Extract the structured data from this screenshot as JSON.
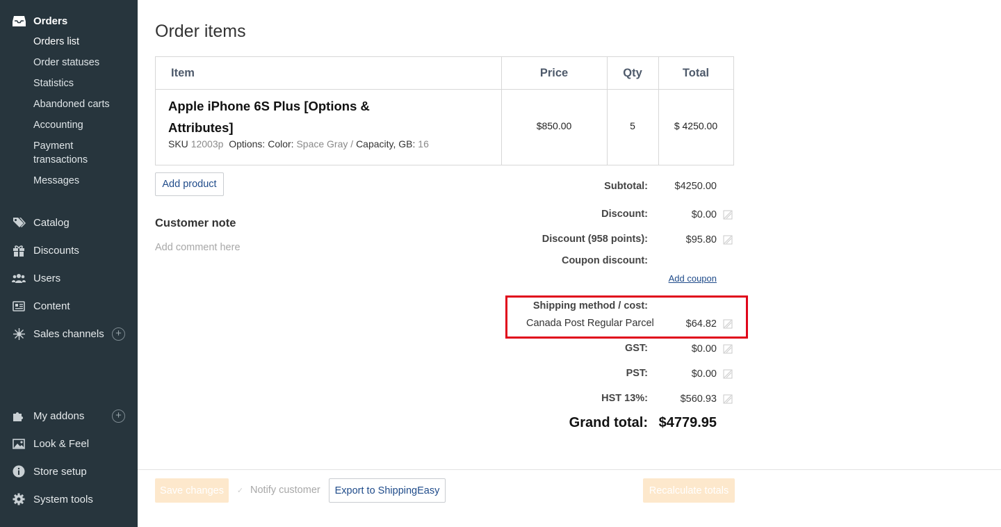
{
  "sidebar": {
    "orders": {
      "label": "Orders",
      "icon": "orders-inbox-icon",
      "items": [
        {
          "label": "Orders list"
        },
        {
          "label": "Order statuses"
        },
        {
          "label": "Statistics"
        },
        {
          "label": "Abandoned carts"
        },
        {
          "label": "Accounting"
        },
        {
          "label": "Payment"
        },
        {
          "label": "transactions"
        },
        {
          "label": "Messages"
        }
      ]
    },
    "sections": [
      {
        "label": "Catalog",
        "icon": "tags-icon"
      },
      {
        "label": "Discounts",
        "icon": "gift-icon"
      },
      {
        "label": "Users",
        "icon": "users-icon"
      },
      {
        "label": "Content",
        "icon": "newspaper-icon"
      },
      {
        "label": "Sales channels",
        "icon": "network-icon",
        "plus": "+"
      }
    ],
    "bottom": [
      {
        "label": "My addons",
        "icon": "puzzle-icon",
        "plus": "+"
      },
      {
        "label": "Look & Feel",
        "icon": "image-icon"
      },
      {
        "label": "Store setup",
        "icon": "info-icon"
      },
      {
        "label": "System tools",
        "icon": "gear-icon"
      }
    ]
  },
  "main": {
    "title": "Order items",
    "table": {
      "headers": {
        "item": "Item",
        "price": "Price",
        "qty": "Qty",
        "total": "Total"
      },
      "rows": [
        {
          "name": "Apple iPhone 6S Plus [Options & Attributes]",
          "sku_label": "SKU",
          "sku": "12003p",
          "options_label": "Options: Color:",
          "color": "Space Gray",
          "separator": "/",
          "capacity_label": "Capacity, GB:",
          "capacity": "16",
          "price": "$850.00",
          "qty": "5",
          "total": "$ 4250.00"
        }
      ]
    },
    "add_product": "Add product",
    "customer_note": {
      "title": "Customer note",
      "placeholder": "Add comment here"
    },
    "totals": {
      "subtotal_label": "Subtotal:",
      "subtotal": "$4250.00",
      "discount_label": "Discount:",
      "discount": "$0.00",
      "points_label": "Discount (958 points):",
      "points": "$95.80",
      "coupon_label": "Coupon discount:",
      "add_coupon": "Add coupon",
      "shipping_label": "Shipping method / cost:",
      "shipping_method": "Canada Post Regular Parcel",
      "shipping_cost": "$64.82",
      "gst_label": "GST:",
      "gst": "$0.00",
      "pst_label": "PST:",
      "pst": "$0.00",
      "hst_label": "HST 13%:",
      "hst": "$560.93",
      "grand_label": "Grand total:",
      "grand": "$4779.95"
    },
    "highlight_color": "#e0061b"
  },
  "footer": {
    "save": "Save changes",
    "notify": "Notify customer",
    "export": "Export to ShippingEasy",
    "recalculate": "Recalculate totals"
  },
  "colors": {
    "sidebar": "#27353d",
    "link": "#1f4b8a",
    "disabled_button": "#fde8cc"
  }
}
